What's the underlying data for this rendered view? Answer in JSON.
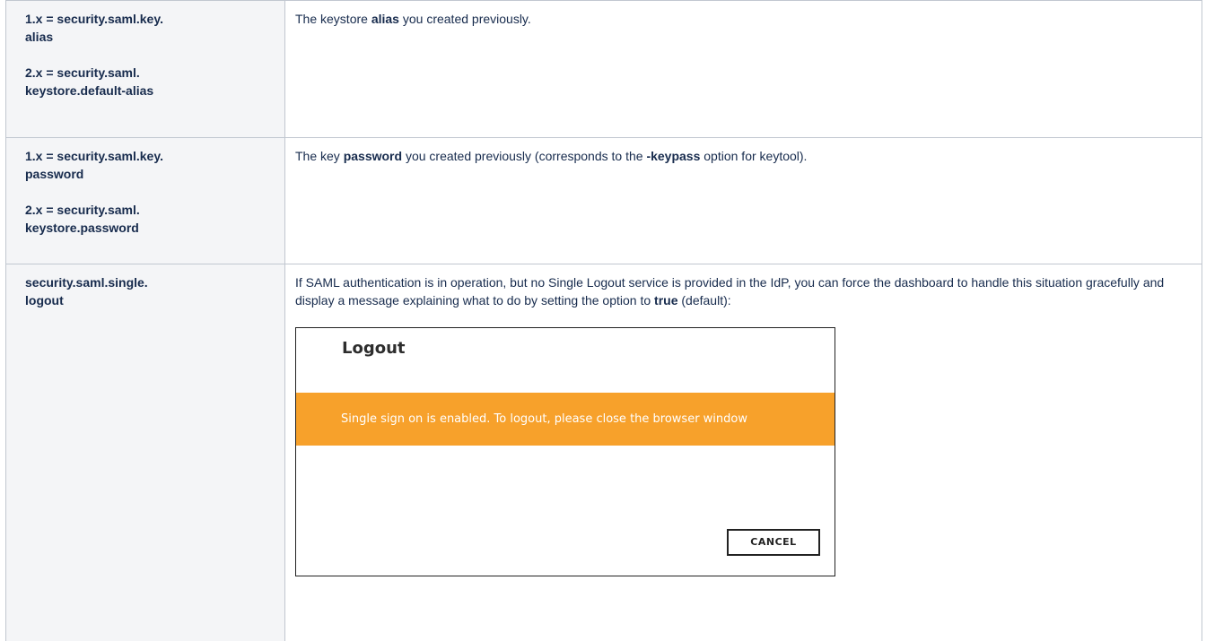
{
  "rows": [
    {
      "keys": [
        "1.x = security.saml.key.\nalias",
        "2.x = security.saml.\nkeystore.default-alias"
      ],
      "desc": {
        "pre": "The keystore ",
        "bold1": "alias",
        "post": " you created previously."
      }
    },
    {
      "keys": [
        "1.x = security.saml.key.\npassword",
        "2.x = security.saml.\nkeystore.password"
      ],
      "desc": {
        "pre": "The key ",
        "bold1": "password",
        "mid": " you created previously (corresponds to the ",
        "bold2": "-keypass",
        "post": " option for keytool)."
      }
    },
    {
      "keys": [
        "security.saml.single.\nlogout"
      ],
      "desc": {
        "pre": "If SAML authentication is in operation, but no Single Logout service is provided in the IdP, you can force the dashboard to handle this situation gracefully and display a message explaining what to do by setting the option to ",
        "bold1": "true",
        "post": " (default):"
      },
      "screenshot": {
        "title": "Logout",
        "banner": "Single sign on is enabled. To logout, please close the browser window",
        "cancel_label": "CANCEL",
        "banner_color": "#f7a12b"
      }
    }
  ]
}
